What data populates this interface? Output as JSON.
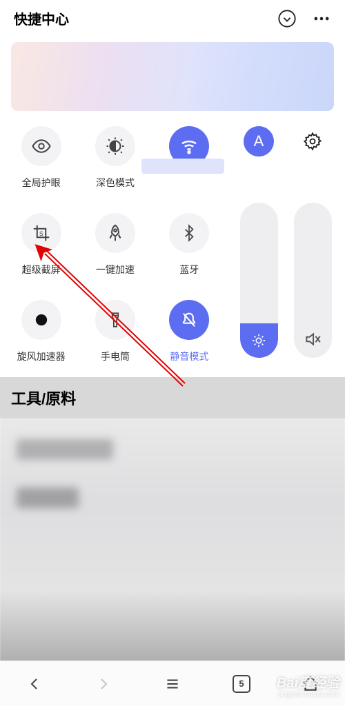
{
  "header": {
    "title": "快捷中心"
  },
  "tiles": {
    "eye": "全局护眼",
    "dark": "深色模式",
    "wifi": "",
    "screenshot": "超级截屏",
    "boost": "一键加速",
    "bluetooth": "蓝牙",
    "spin": "旋风加速器",
    "torch": "手电筒",
    "silent": "静音模式"
  },
  "side": {
    "auto_label": "A"
  },
  "section": {
    "tools": "工具/原料"
  },
  "nav": {
    "tab_count": "5"
  },
  "watermark": {
    "brand": "Bai度经验",
    "sub": "jingyan.baidu.com"
  }
}
